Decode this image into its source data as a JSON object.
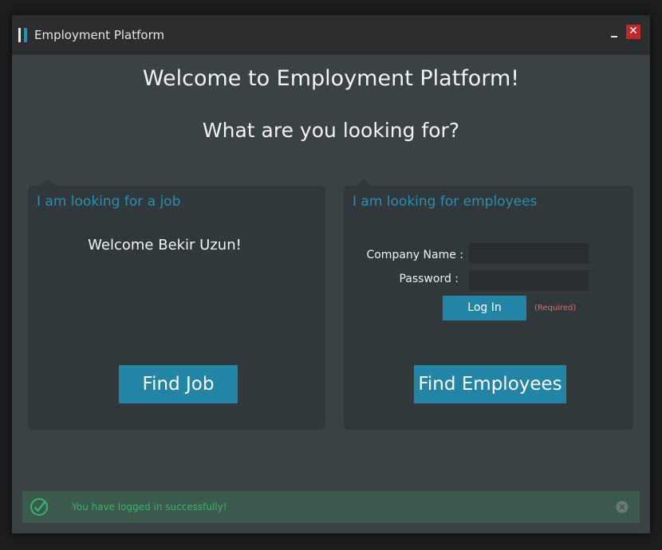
{
  "window": {
    "title": "Employment Platform"
  },
  "header": {
    "welcome": "Welcome to Employment Platform!",
    "question": "What are you looking for?"
  },
  "job_panel": {
    "title": "I am looking for a job",
    "welcome_user": "Welcome Bekir Uzun!",
    "button": "Find Job"
  },
  "employee_panel": {
    "title": "I am looking for employees",
    "company_label": "Company Name :",
    "company_value": "",
    "password_label": "Password :",
    "password_value": "",
    "login_button": "Log In",
    "required_note": "(Required)",
    "button": "Find Employees"
  },
  "notification": {
    "message": "You have logged in successfully!",
    "icon": "check-circle-icon",
    "close_icon": "close-circle-icon"
  },
  "colors": {
    "accent": "#2385a5",
    "window_bg": "#3a4245",
    "panel_bg": "#30383b",
    "success": "#35b46a",
    "close": "#c0282a"
  }
}
